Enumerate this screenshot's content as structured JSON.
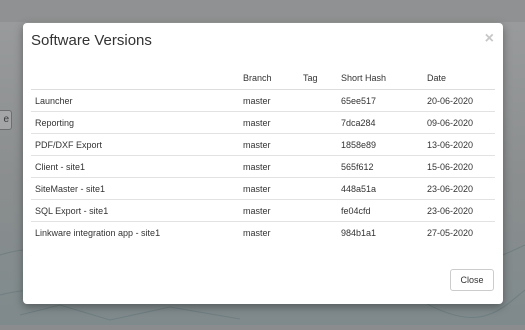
{
  "background": {
    "button_fragment": "e"
  },
  "modal": {
    "title": "Software Versions",
    "close_glyph": "×",
    "table": {
      "headers": [
        "",
        "Branch",
        "Tag",
        "Short Hash",
        "Date"
      ],
      "rows": [
        {
          "name": "Launcher",
          "branch": "master",
          "tag": "",
          "hash": "65ee517",
          "date": "20-06-2020"
        },
        {
          "name": "Reporting",
          "branch": "master",
          "tag": "",
          "hash": "7dca284",
          "date": "09-06-2020"
        },
        {
          "name": "PDF/DXF Export",
          "branch": "master",
          "tag": "",
          "hash": "1858e89",
          "date": "13-06-2020"
        },
        {
          "name": "Client - site1",
          "branch": "master",
          "tag": "",
          "hash": "565f612",
          "date": "15-06-2020"
        },
        {
          "name": "SiteMaster - site1",
          "branch": "master",
          "tag": "",
          "hash": "448a51a",
          "date": "23-06-2020"
        },
        {
          "name": "SQL Export - site1",
          "branch": "master",
          "tag": "",
          "hash": "fe04cfd",
          "date": "23-06-2020"
        },
        {
          "name": "Linkware integration app - site1",
          "branch": "master",
          "tag": "",
          "hash": "984b1a1",
          "date": "27-05-2020"
        }
      ]
    },
    "footer": {
      "close_label": "Close"
    }
  },
  "colors": {
    "overlay": "#8b8e8f",
    "modal_bg": "#ffffff",
    "row_divider": "#e2e2e2",
    "button_border": "#cccccc"
  }
}
